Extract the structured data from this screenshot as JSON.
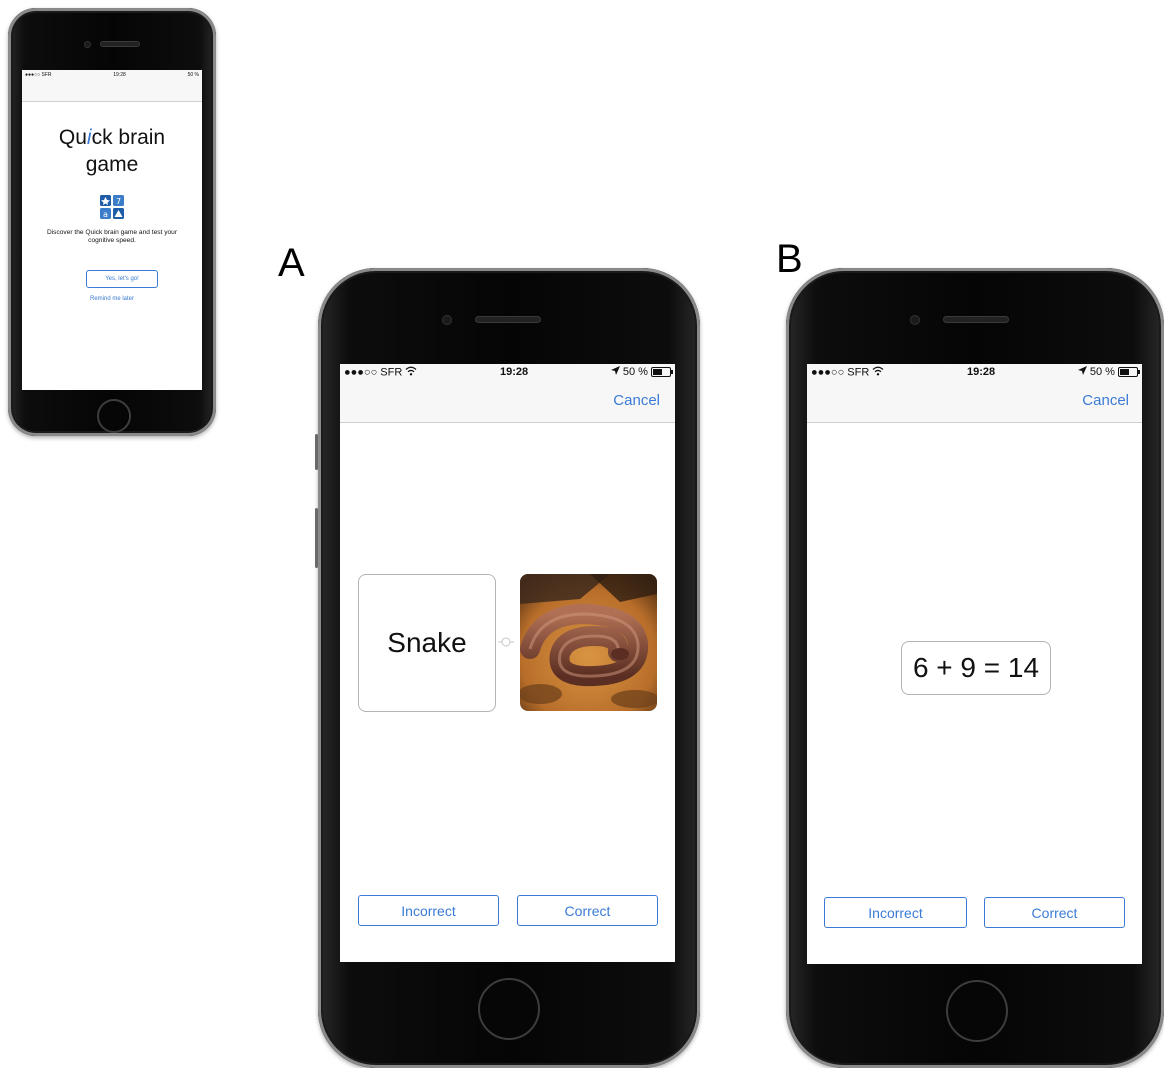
{
  "labels": {
    "panel_a": "A",
    "panel_b": "B"
  },
  "status_bar": {
    "carrier": "●●●○○ SFR",
    "wifi_icon": "wifi-icon",
    "time": "19:28",
    "location_icon": "location-arrow-icon",
    "battery": "50 %",
    "battery_level": 0.5
  },
  "intro_screen": {
    "title_line1_pre": "Qu",
    "title_line1_i": "i",
    "title_line1_post": "ck brain",
    "title_line2": "game",
    "logo_icon": "quick-brain-logo-icon",
    "description": "Discover the Quick brain game and test your cognitive speed.",
    "primary_button": "Yes, let's go!",
    "secondary_link": "Remind me later"
  },
  "screen_a": {
    "cancel": "Cancel",
    "word_card": "Snake",
    "link_icon": "link-icon",
    "image_alt": "snake-photo",
    "incorrect": "Incorrect",
    "correct": "Correct"
  },
  "screen_b": {
    "cancel": "Cancel",
    "equation": "6 + 9 = 14",
    "incorrect": "Incorrect",
    "correct": "Correct"
  },
  "colors": {
    "accent": "#3b7bd6",
    "logo_blue": "#1f5da8"
  }
}
